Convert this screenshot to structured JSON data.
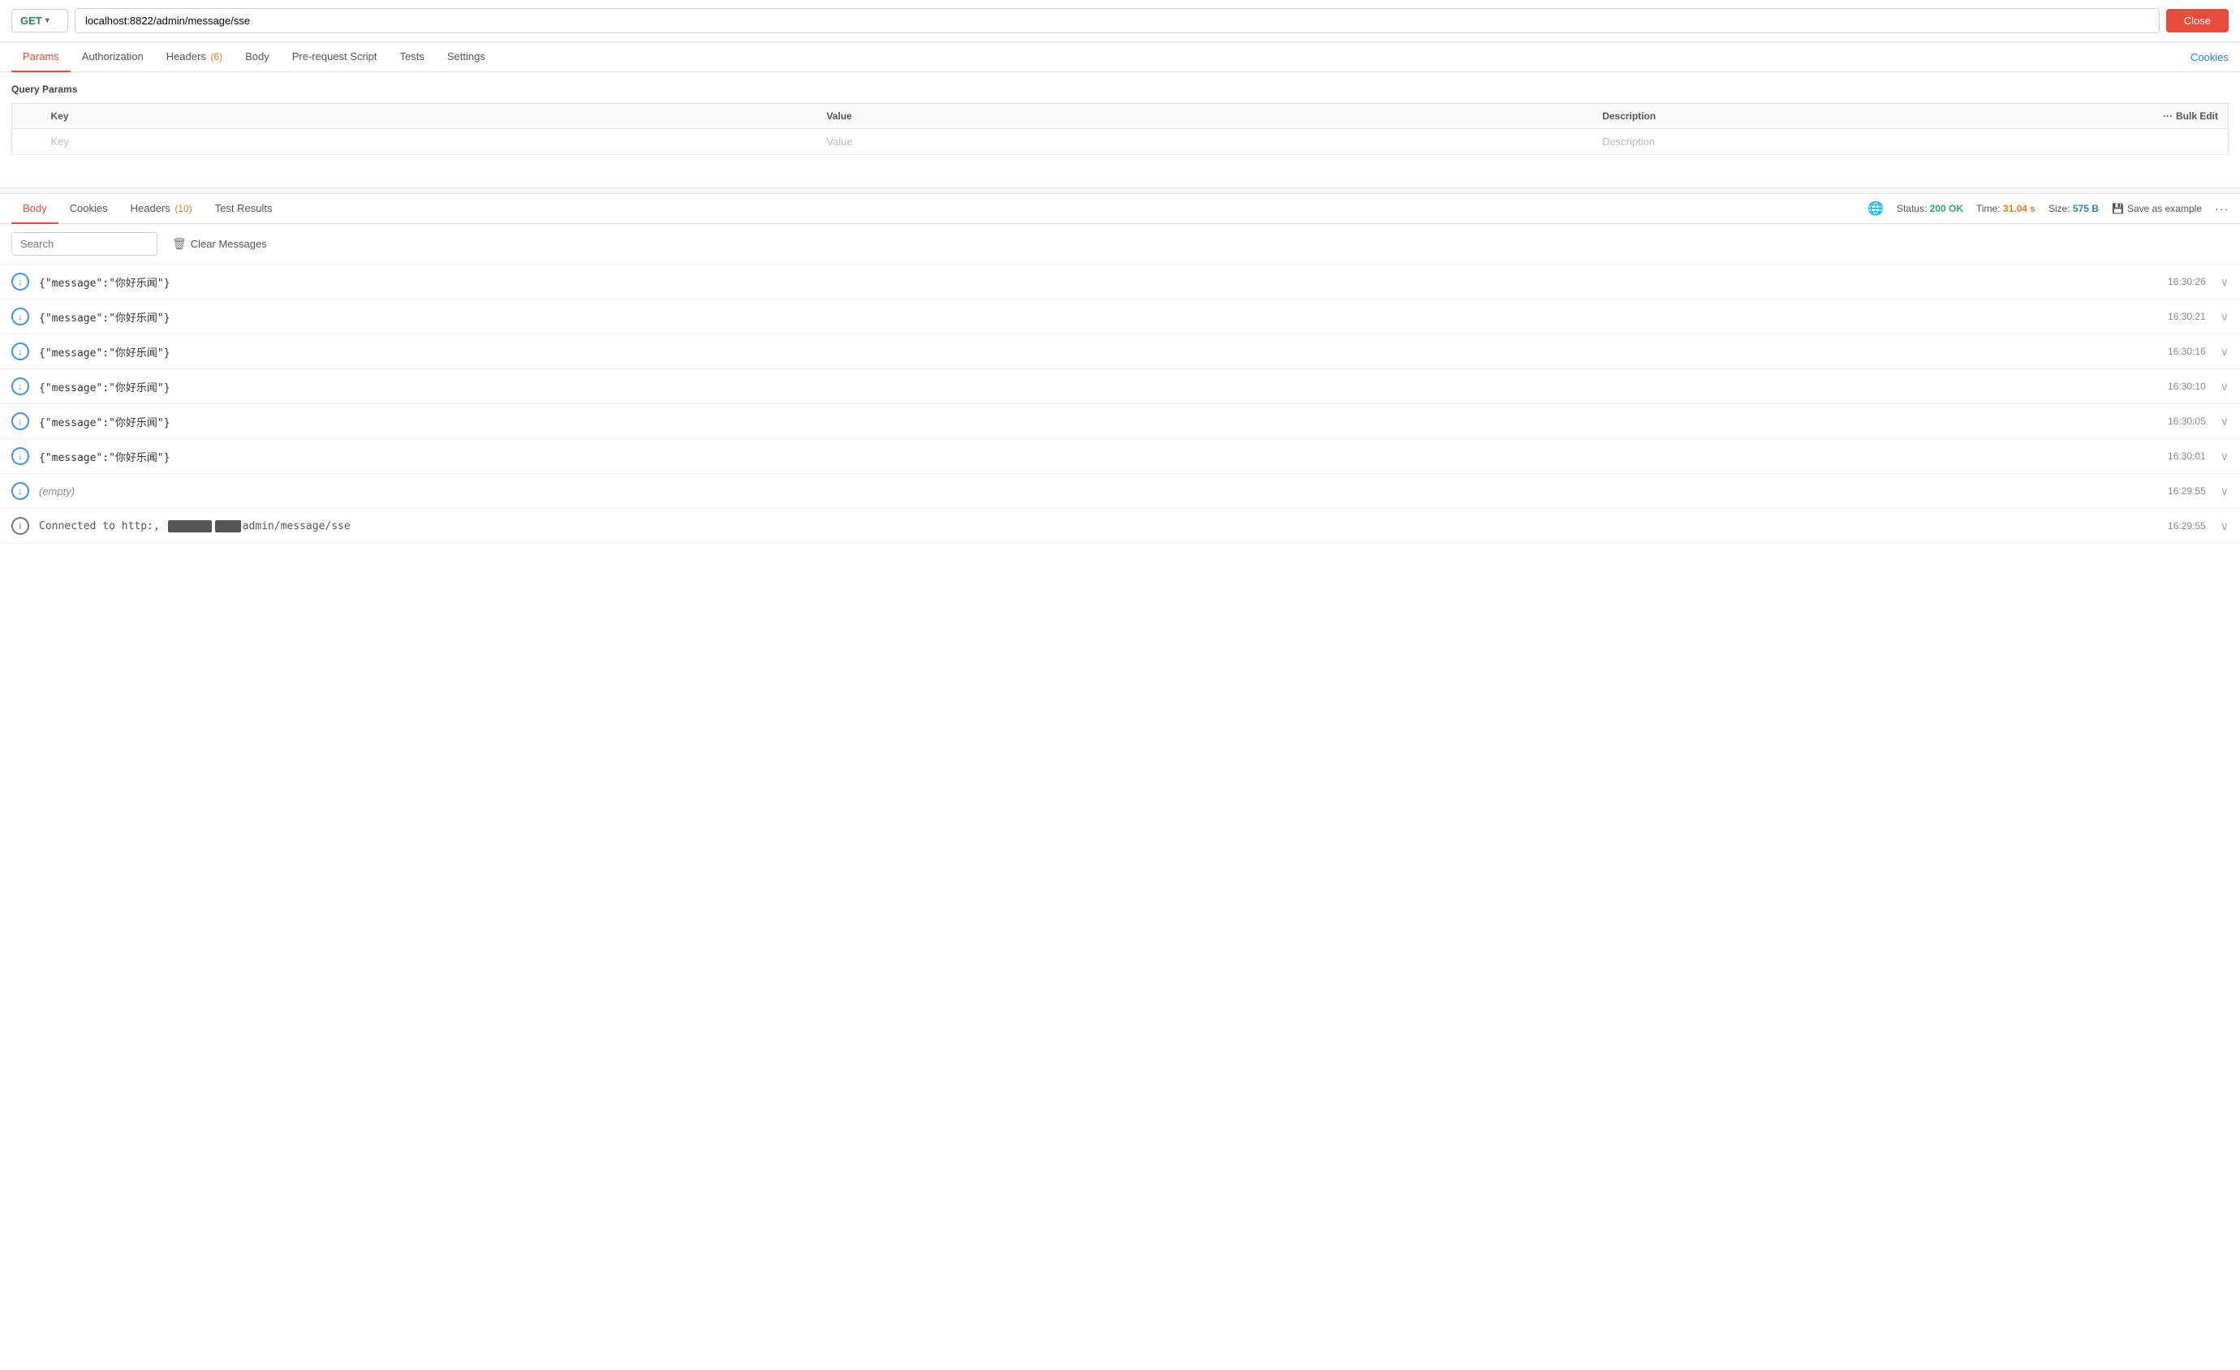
{
  "url_bar": {
    "method": "GET",
    "url": "localhost:8822/admin/message/sse",
    "close_label": "Close"
  },
  "req_tabs": {
    "tabs": [
      {
        "label": "Params",
        "active": true,
        "badge": null
      },
      {
        "label": "Authorization",
        "active": false,
        "badge": null
      },
      {
        "label": "Headers",
        "active": false,
        "badge": "(6)"
      },
      {
        "label": "Body",
        "active": false,
        "badge": null
      },
      {
        "label": "Pre-request Script",
        "active": false,
        "badge": null
      },
      {
        "label": "Tests",
        "active": false,
        "badge": null
      },
      {
        "label": "Settings",
        "active": false,
        "badge": null
      }
    ],
    "right_link": "Cookies"
  },
  "query_params": {
    "section_title": "Query Params",
    "columns": [
      "Key",
      "Value",
      "Description",
      "Bulk Edit"
    ],
    "placeholder_key": "Key",
    "placeholder_val": "Value",
    "placeholder_desc": "Description",
    "bulk_edit_label": "Bulk Edit"
  },
  "resp_tabs": {
    "tabs": [
      {
        "label": "Body",
        "active": true,
        "badge": null
      },
      {
        "label": "Cookies",
        "active": false,
        "badge": null
      },
      {
        "label": "Headers",
        "active": false,
        "badge": "(10)"
      },
      {
        "label": "Test Results",
        "active": false,
        "badge": null
      }
    ],
    "status_label": "Status:",
    "status_value": "200 OK",
    "time_label": "Time:",
    "time_value": "31.04 s",
    "size_label": "Size:",
    "size_value": "575 B",
    "save_example_label": "Save as example",
    "more_icon": "···"
  },
  "search_bar": {
    "placeholder": "Search",
    "clear_label": "Clear Messages"
  },
  "messages": [
    {
      "type": "arrow",
      "content": "{\"message\":\"你好乐闻\"}",
      "time": "16:30:26",
      "empty": false
    },
    {
      "type": "arrow",
      "content": "{\"message\":\"你好乐闻\"}",
      "time": "16:30:21",
      "empty": false
    },
    {
      "type": "arrow",
      "content": "{\"message\":\"你好乐闻\"}",
      "time": "16:30:16",
      "empty": false
    },
    {
      "type": "arrow",
      "content": "{\"message\":\"你好乐闻\"}",
      "time": "16:30:10",
      "empty": false
    },
    {
      "type": "arrow",
      "content": "{\"message\":\"你好乐闻\"}",
      "time": "16:30:05",
      "empty": false
    },
    {
      "type": "arrow",
      "content": "{\"message\":\"你好乐闻\"}",
      "time": "16:30:01",
      "empty": false
    },
    {
      "type": "arrow",
      "content": "(empty)",
      "time": "16:29:55",
      "empty": true
    },
    {
      "type": "info",
      "content": "Connected to http:,    admin/message/sse",
      "time": "16:29:55",
      "empty": false,
      "connected": true
    }
  ]
}
